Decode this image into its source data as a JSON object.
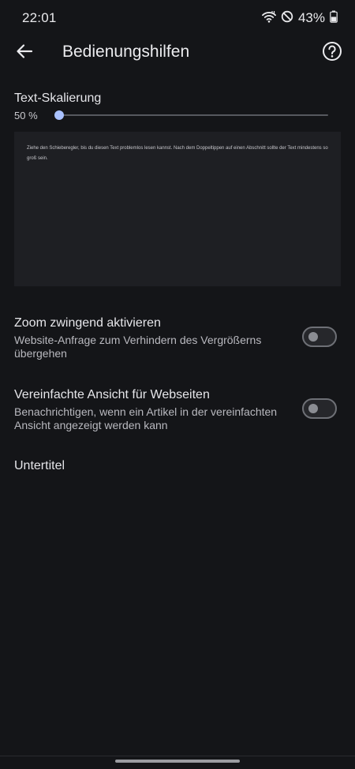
{
  "status_bar": {
    "time": "22:01",
    "battery_text": "43%",
    "icons": [
      "wifi-icon",
      "do-not-disturb-icon",
      "battery-icon"
    ]
  },
  "header": {
    "title": "Bedienungshilfen",
    "back_icon": "arrow-left-icon",
    "help_icon": "help-circle-icon"
  },
  "text_scaling": {
    "label": "Text-Skalierung",
    "value_text": "50 %",
    "slider_fraction": 0.0,
    "preview_text": "Ziehe den Schieberegler, bis du diesen Text problemlos lesen kannst. Nach dem Doppeltippen auf einen Abschnitt sollte der Text mindestens so groß sein."
  },
  "settings": [
    {
      "title": "Zoom zwingend aktivieren",
      "summary": "Website-Anfrage zum Verhindern des Vergrößerns übergehen",
      "enabled": false
    },
    {
      "title": "Vereinfachte Ansicht für Webseiten",
      "summary": "Benachrichtigen, wenn ein Artikel in der vereinfachten Ansicht angezeigt werden kann",
      "enabled": false
    }
  ],
  "captions": {
    "title": "Untertitel"
  },
  "colors": {
    "background": "#141518",
    "accent": "#a9c1ff",
    "preview_background": "#1e1f23"
  }
}
